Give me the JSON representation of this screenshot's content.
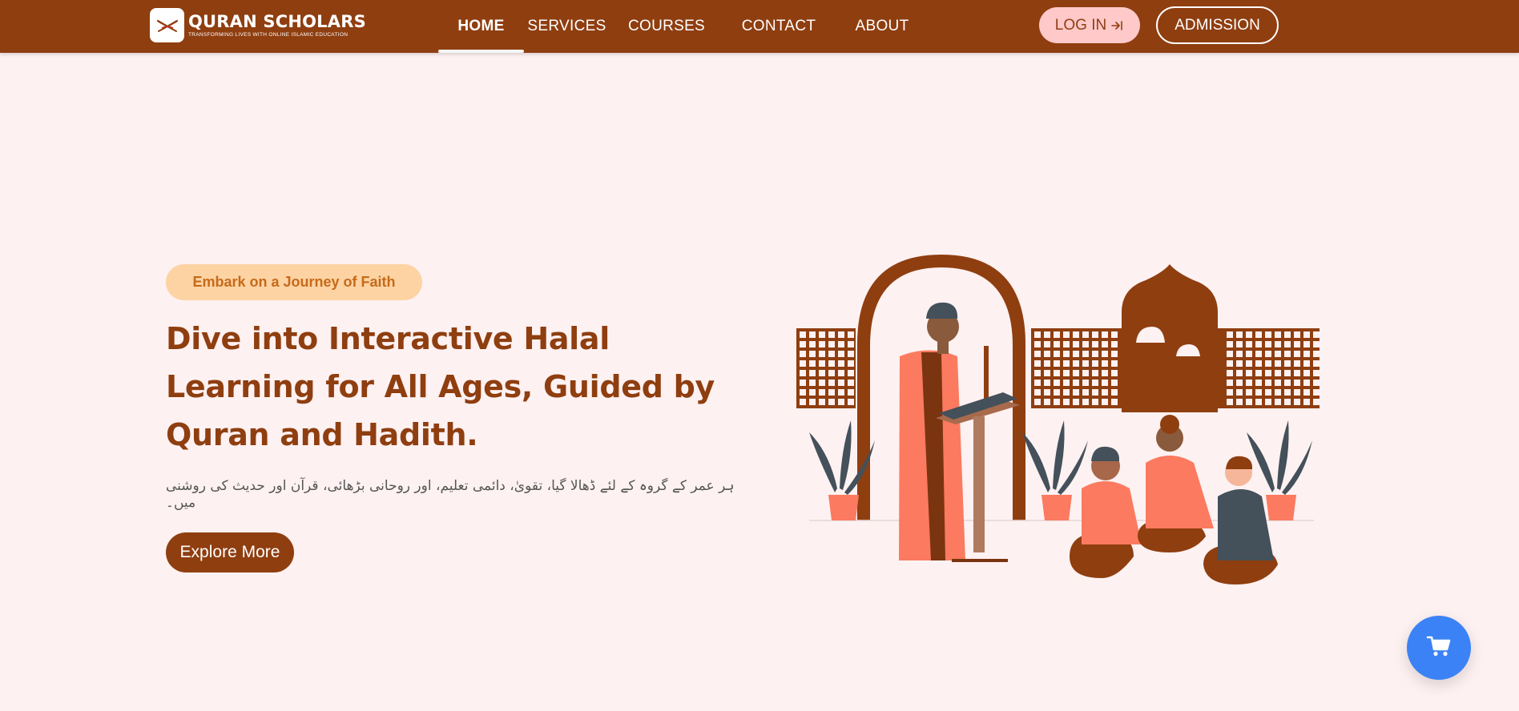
{
  "brand": {
    "name": "QURAN SCHOLARS",
    "tagline": "TRANSFORMING LIVES WITH ONLINE ISLAMIC EDUCATION"
  },
  "nav": {
    "items": [
      {
        "label": "HOME",
        "active": true
      },
      {
        "label": "SERVICES",
        "active": false
      },
      {
        "label": "COURSES",
        "active": false
      },
      {
        "label": "CONTACT",
        "active": false
      },
      {
        "label": "ABOUT",
        "active": false
      }
    ],
    "login_label": "LOG IN",
    "admission_label": "ADMISSION"
  },
  "hero": {
    "badge": "Embark on a Journey of Faith",
    "title": "Dive into Interactive Halal Learning for All Ages, Guided by Quran and Hadith.",
    "subtitle": "ہر عمر کے گروہ کے لئے ڈھالا گیا، تقویٰ، دائمی تعلیم، اور روحانی بڑھائی، قرآن اور حدیث کی روشنی میں۔",
    "cta_label": "Explore More"
  },
  "icons": {
    "logo": "open-book-icon",
    "login": "login-arrow-icon",
    "cart": "shopping-cart-icon"
  },
  "colors": {
    "primary": "#8f3e10",
    "background": "#fdf1f1",
    "badge_bg": "#fdd3a3",
    "login_bg": "#ffc9c9",
    "cart_bg": "#3b82f6",
    "accent_coral": "#fb7a60"
  }
}
